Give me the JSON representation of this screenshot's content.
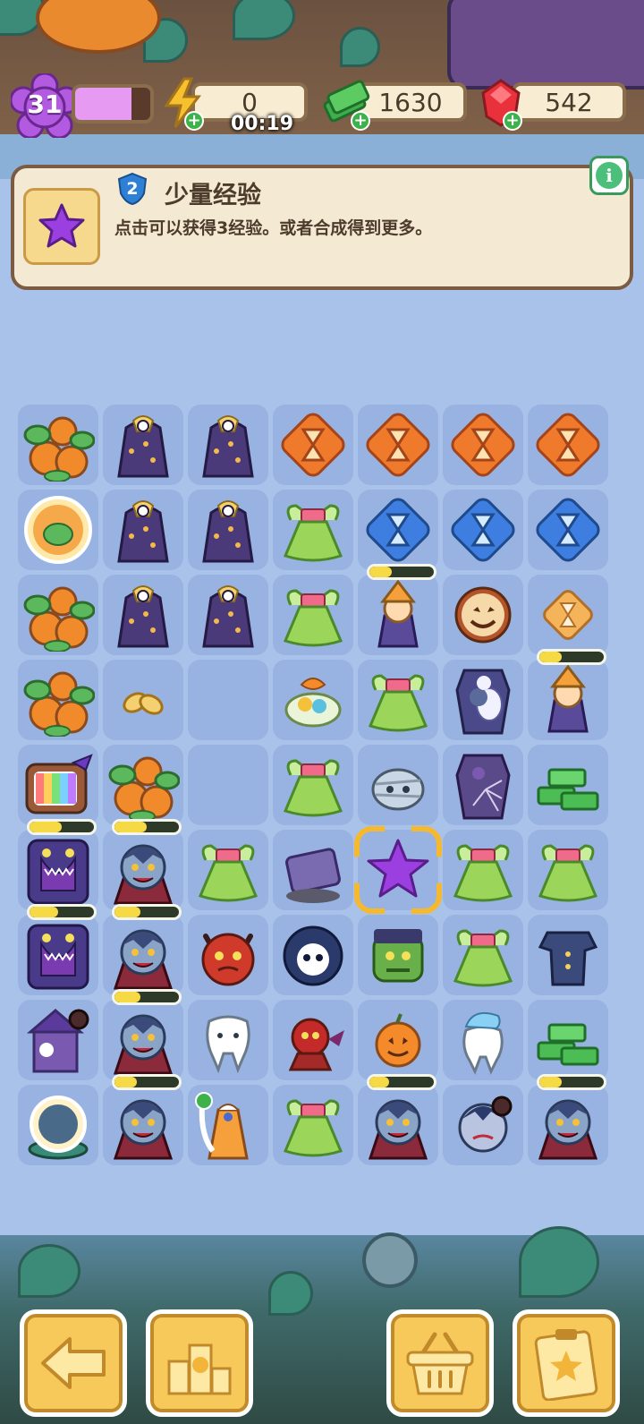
{
  "header": {
    "level": "31",
    "xp_fraction": 0.75,
    "energy": "0",
    "energy_timer": "00:19",
    "cash": "1630",
    "gems": "542"
  },
  "info_panel": {
    "item_level": "2",
    "title": "少量经验",
    "description": "点击可以获得3经验。或者合成得到更多。",
    "info_button": "i"
  },
  "board": {
    "rows": [
      [
        "pumpkin-patch",
        "wizard-robe",
        "wizard-robe",
        "hourglass-orange",
        "hourglass-orange",
        "hourglass-orange",
        "hourglass-orange"
      ],
      [
        "pumpkin-orb",
        "wizard-robe",
        "wizard-robe",
        "fairy-dress",
        "hourglass-blue",
        "hourglass-blue",
        "hourglass-blue"
      ],
      [
        "pumpkin-patch",
        "wizard-robe",
        "wizard-robe",
        "fairy-dress",
        "witch-girl",
        "jack-o-lantern-cookie",
        "hourglass-small"
      ],
      [
        "pumpkin-patch",
        "seeds",
        "empty",
        "candy-bowl",
        "fairy-dress",
        "ghost-coffin",
        "witch-girl"
      ],
      [
        "tv-generator",
        "pumpkin-patch",
        "empty",
        "fairy-dress",
        "mummy-head",
        "spider-coffin",
        "cash-pile"
      ],
      [
        "monster-cabinet",
        "vampire",
        "fairy-dress",
        "grave-stone",
        "purple-star",
        "fairy-dress",
        "fairy-dress"
      ],
      [
        "monster-cabinet",
        "vampire",
        "devil-head",
        "reaper-skull",
        "frankenstein",
        "fairy-dress",
        "pajamas"
      ],
      [
        "haunted-house",
        "vampire",
        "tooth",
        "red-devil",
        "pumpkin-small",
        "tooth-hat",
        "cash-pile"
      ],
      [
        "crystal-orb",
        "vampire",
        "royal-gown",
        "fairy-dress",
        "vampire",
        "vampire-boy",
        "vampire"
      ]
    ],
    "progress": [
      [
        null,
        null,
        null,
        null,
        null,
        null,
        null
      ],
      [
        null,
        null,
        null,
        null,
        null,
        null,
        null
      ],
      [
        null,
        null,
        null,
        null,
        0.35,
        null,
        null
      ],
      [
        null,
        null,
        null,
        null,
        null,
        null,
        0.35
      ],
      [
        null,
        null,
        null,
        null,
        null,
        null,
        null
      ],
      [
        0.5,
        0.5,
        null,
        null,
        null,
        null,
        null
      ],
      [
        0.45,
        0.4,
        null,
        null,
        null,
        null,
        null
      ],
      [
        null,
        0.4,
        null,
        null,
        null,
        null,
        null
      ],
      [
        null,
        0.35,
        null,
        null,
        0.3,
        null,
        0.35
      ]
    ],
    "selected": [
      5,
      4
    ]
  },
  "bottom_bar": {
    "buttons": [
      "back",
      "leaderboard",
      "shop-basket",
      "tasks-clipboard"
    ]
  },
  "colors": {
    "board_bg": "#a9c2ea",
    "cell_bg": "#98b3e2",
    "panel_bg": "#f4ead3",
    "button_bg": "#f7c95a",
    "xp_fill": "#e79af2",
    "star_purple": "#9b3fe0"
  }
}
